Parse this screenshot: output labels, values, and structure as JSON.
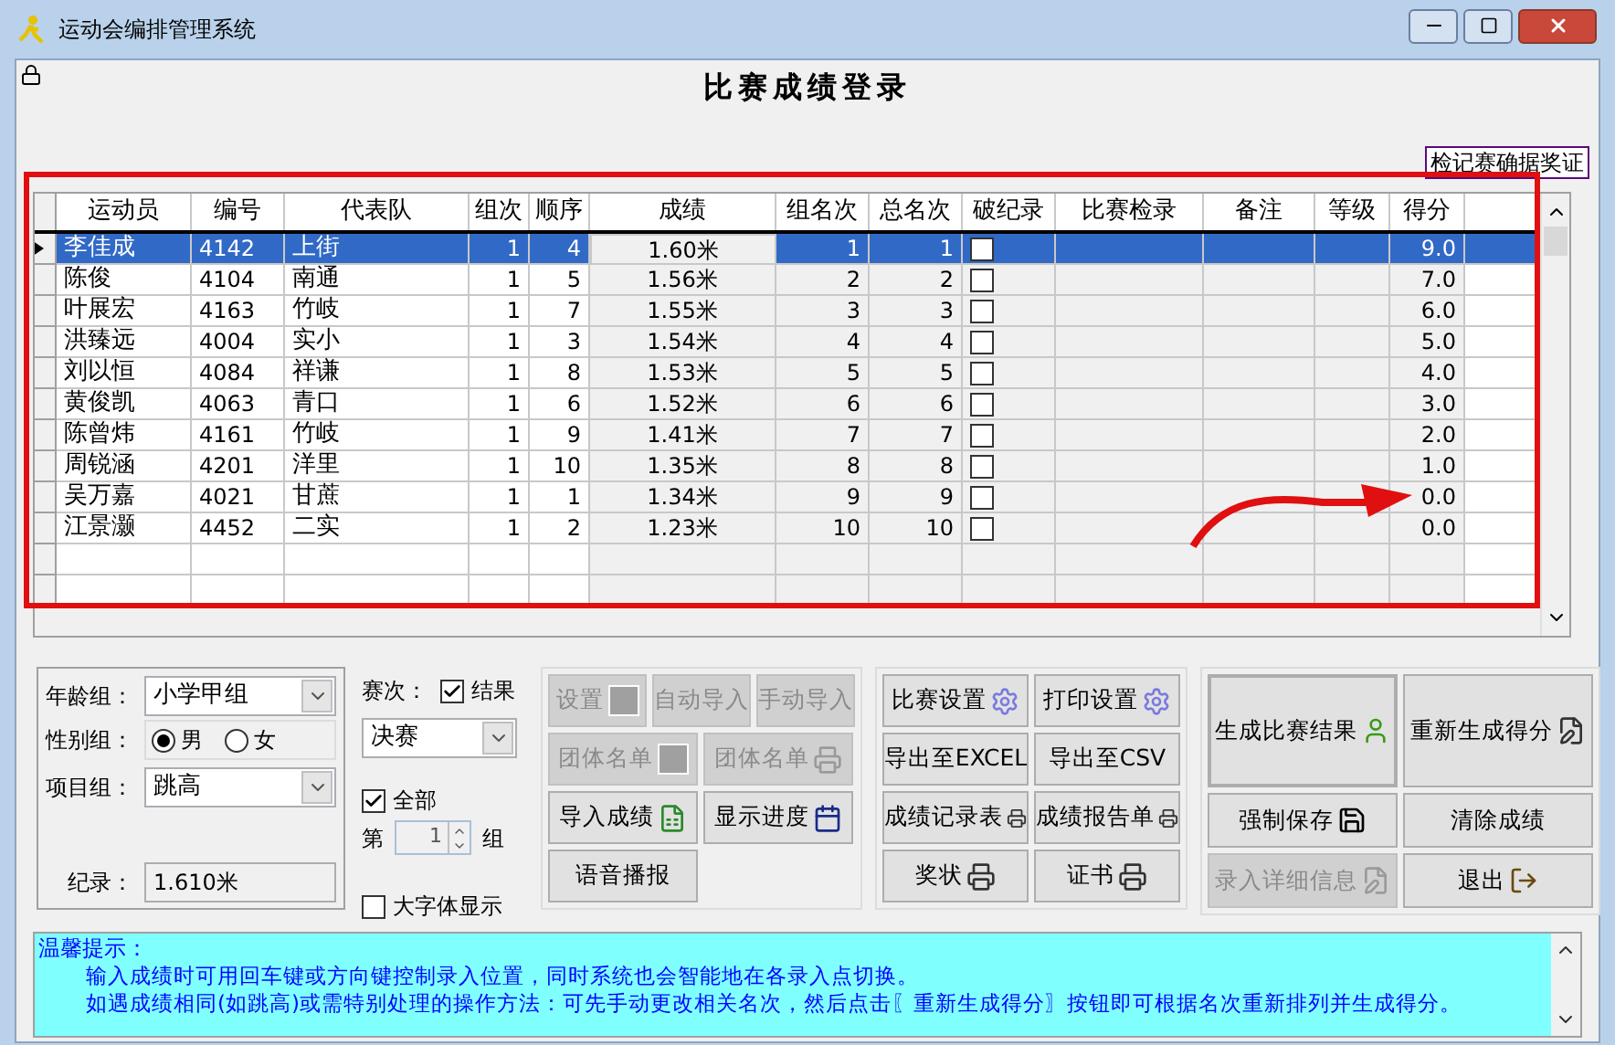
{
  "window": {
    "title": "运动会编排管理系统"
  },
  "heading": "比赛成绩登录",
  "verify_label": "检记赛确据奖证",
  "table": {
    "columns": [
      "运动员",
      "编号",
      "代表队",
      "组次",
      "顺序",
      "成绩",
      "组名次",
      "总名次",
      "破纪录",
      "比赛检录",
      "备注",
      "等级",
      "得分"
    ],
    "rows": [
      {
        "athlete": "李佳成",
        "number": "4142",
        "team": "上街",
        "group": "1",
        "order": "4",
        "result": "1.60米",
        "group_rank": "1",
        "overall_rank": "1",
        "record_broken": false,
        "score": "9.0",
        "selected": true
      },
      {
        "athlete": "陈俊",
        "number": "4104",
        "team": "南通",
        "group": "1",
        "order": "5",
        "result": "1.56米",
        "group_rank": "2",
        "overall_rank": "2",
        "record_broken": false,
        "score": "7.0",
        "selected": false
      },
      {
        "athlete": "叶展宏",
        "number": "4163",
        "team": "竹岐",
        "group": "1",
        "order": "7",
        "result": "1.55米",
        "group_rank": "3",
        "overall_rank": "3",
        "record_broken": false,
        "score": "6.0",
        "selected": false
      },
      {
        "athlete": "洪臻远",
        "number": "4004",
        "team": "实小",
        "group": "1",
        "order": "3",
        "result": "1.54米",
        "group_rank": "4",
        "overall_rank": "4",
        "record_broken": false,
        "score": "5.0",
        "selected": false
      },
      {
        "athlete": "刘以恒",
        "number": "4084",
        "team": "祥谦",
        "group": "1",
        "order": "8",
        "result": "1.53米",
        "group_rank": "5",
        "overall_rank": "5",
        "record_broken": false,
        "score": "4.0",
        "selected": false
      },
      {
        "athlete": "黄俊凯",
        "number": "4063",
        "team": "青口",
        "group": "1",
        "order": "6",
        "result": "1.52米",
        "group_rank": "6",
        "overall_rank": "6",
        "record_broken": false,
        "score": "3.0",
        "selected": false
      },
      {
        "athlete": "陈曾炜",
        "number": "4161",
        "team": "竹岐",
        "group": "1",
        "order": "9",
        "result": "1.41米",
        "group_rank": "7",
        "overall_rank": "7",
        "record_broken": false,
        "score": "2.0",
        "selected": false
      },
      {
        "athlete": "周锐涵",
        "number": "4201",
        "team": "洋里",
        "group": "1",
        "order": "10",
        "result": "1.35米",
        "group_rank": "8",
        "overall_rank": "8",
        "record_broken": false,
        "score": "1.0",
        "selected": false
      },
      {
        "athlete": "吴万嘉",
        "number": "4021",
        "team": "甘蔗",
        "group": "1",
        "order": "1",
        "result": "1.34米",
        "group_rank": "9",
        "overall_rank": "9",
        "record_broken": false,
        "score": "0.0",
        "selected": false
      },
      {
        "athlete": "江景灏",
        "number": "4452",
        "team": "二实",
        "group": "1",
        "order": "2",
        "result": "1.23米",
        "group_rank": "10",
        "overall_rank": "10",
        "record_broken": false,
        "score": "0.0",
        "selected": false
      }
    ]
  },
  "filters": {
    "age_group_label": "年龄组：",
    "age_group": "小学甲组",
    "gender_label": "性别组：",
    "genders": [
      {
        "label": "男",
        "selected": true
      },
      {
        "label": "女",
        "selected": false
      }
    ],
    "event_label": "项目组：",
    "event": "跳高",
    "record_label": "纪录：",
    "record": "1.610米"
  },
  "round": {
    "label": "赛次：",
    "result_check": {
      "label": "结果",
      "checked": true
    },
    "round": "决赛",
    "all_check": {
      "label": "全部",
      "checked": true
    },
    "group_prefix": "第",
    "group_value": "1",
    "group_suffix": "组",
    "large_font": {
      "label": "大字体显示",
      "checked": false
    }
  },
  "panels": [
    {
      "rows": [
        [
          {
            "label": "设置",
            "disabled": true,
            "focused": false
          },
          {
            "label": "自动导入",
            "disabled": true,
            "focused": false
          },
          {
            "label": "手动导入",
            "disabled": true,
            "focused": false
          }
        ],
        [
          {
            "label": "团体名单",
            "disabled": true,
            "focused": false
          },
          {
            "label": "团体名单",
            "disabled": true,
            "focused": false
          }
        ],
        [
          {
            "label": "导入成绩",
            "disabled": false,
            "focused": false
          },
          {
            "label": "显示进度",
            "disabled": false,
            "focused": false
          }
        ],
        [
          {
            "label": "语音播报",
            "disabled": false,
            "focused": false
          }
        ]
      ]
    },
    {
      "rows": [
        [
          {
            "label": "比赛设置",
            "disabled": false,
            "focused": false
          },
          {
            "label": "打印设置",
            "disabled": false,
            "focused": false
          }
        ],
        [
          {
            "label": "导出至EXCEL",
            "disabled": false,
            "focused": false
          },
          {
            "label": "导出至CSV",
            "disabled": false,
            "focused": false
          }
        ],
        [
          {
            "label": "成绩记录表",
            "disabled": false,
            "focused": false
          },
          {
            "label": "成绩报告单",
            "disabled": false,
            "focused": false
          }
        ],
        [
          {
            "label": "奖状",
            "disabled": false,
            "focused": false
          },
          {
            "label": "证书",
            "disabled": false,
            "focused": false
          }
        ]
      ]
    },
    {
      "rows": [
        [
          {
            "label": "生成比赛结果",
            "disabled": false,
            "focused": true
          },
          {
            "label": "重新生成得分",
            "disabled": false,
            "focused": false
          }
        ],
        [
          {
            "label": "强制保存",
            "disabled": false,
            "focused": false
          },
          {
            "label": "清除成绩",
            "disabled": false,
            "focused": false
          }
        ],
        [
          {
            "label": "录入详细信息",
            "disabled": true,
            "focused": false
          },
          {
            "label": "退出",
            "disabled": false,
            "focused": false
          }
        ]
      ]
    }
  ],
  "hint": {
    "title": "温馨提示：",
    "lines": [
      "输入成绩时可用回车键或方向键控制录入位置，同时系统也会智能地在各录入点切换。",
      "如遇成绩相同(如跳高)或需特别处理的操作方法：可先手动更改相关名次，然后点击〖重新生成得分〗按钮即可根据名次重新排列并生成得分。"
    ]
  }
}
